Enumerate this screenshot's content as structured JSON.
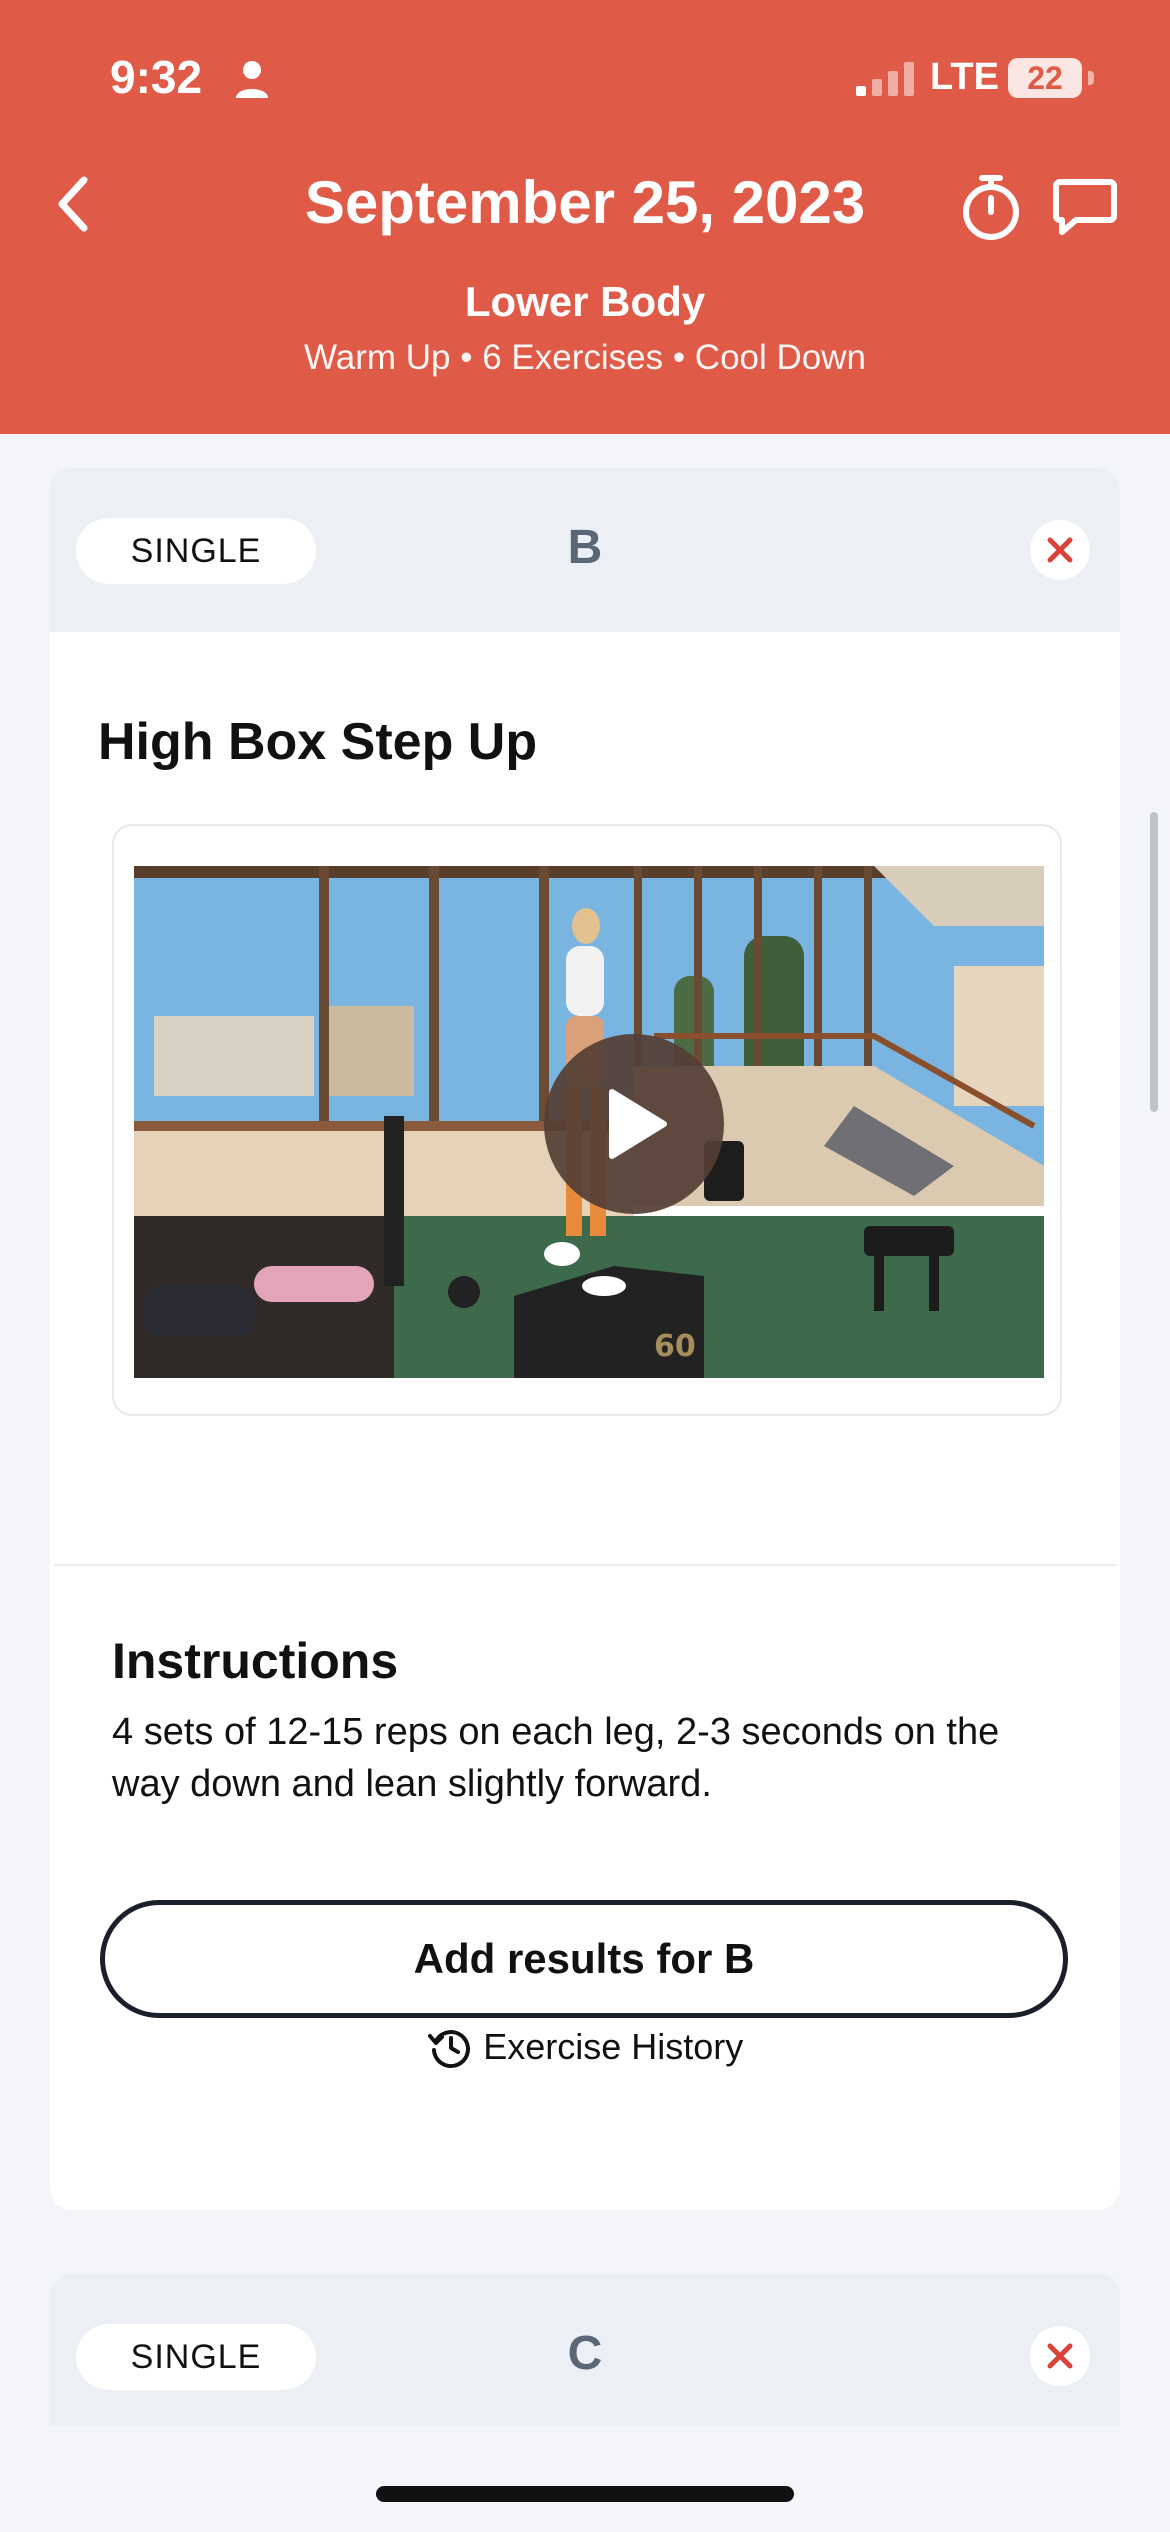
{
  "status_bar": {
    "time": "9:32",
    "network": "LTE",
    "battery": "22"
  },
  "header": {
    "date_title": "September 25, 2023",
    "workout_name": "Lower Body",
    "workout_meta": "Warm Up • 6 Exercises • Cool Down",
    "background_color": "#e05a48"
  },
  "block_b": {
    "type_label": "SINGLE",
    "letter": "B",
    "exercise_title": "High Box Step Up",
    "video": {
      "box_label": "60"
    },
    "instructions_heading": "Instructions",
    "instructions_text": "4 sets of 12-15 reps on each leg, 2-3 seconds on the way down and lean slightly forward.",
    "results_button_label": "Add results for B",
    "history_label": "Exercise History"
  },
  "block_c": {
    "type_label": "SINGLE",
    "letter": "C"
  },
  "icons": {
    "back": "chevron-left-icon",
    "timer": "stopwatch-icon",
    "chat": "chat-bubble-icon",
    "remove": "close-x-icon",
    "play": "play-icon",
    "history": "history-clock-icon"
  },
  "colors": {
    "accent": "#e05a48",
    "remove_x": "#d9433a",
    "letter": "#5b6677"
  }
}
